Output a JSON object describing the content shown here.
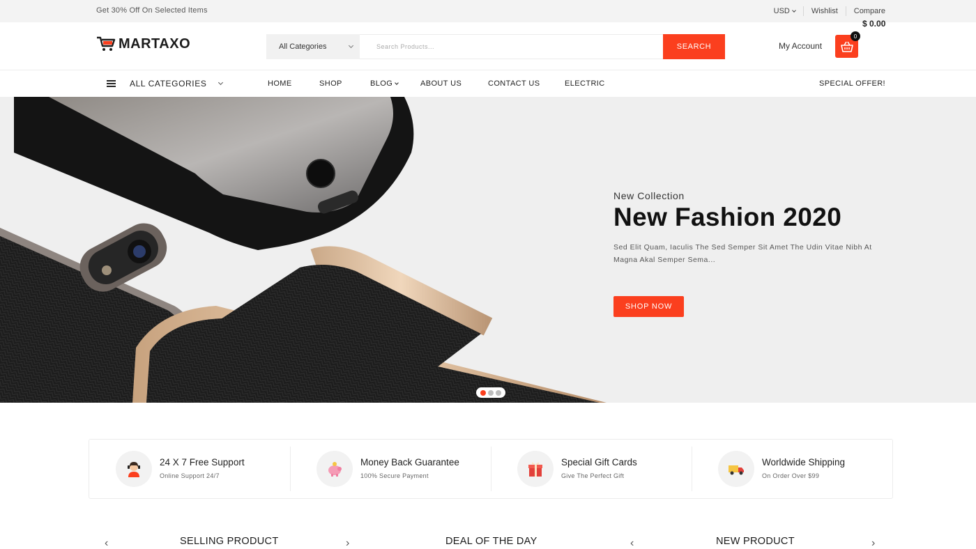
{
  "topbar": {
    "promo": "Get 30% Off On Selected Items",
    "currency": "USD",
    "wishlist": "Wishlist",
    "compare": "Compare"
  },
  "header": {
    "logo_text": "MARTAXO",
    "search": {
      "category_selected": "All Categories",
      "placeholder": "Search Products...",
      "button_label": "SEARCH"
    },
    "account_label": "My Account",
    "cart": {
      "count": "0",
      "total": "$ 0.00"
    }
  },
  "nav": {
    "all_categories": "ALL CATEGORIES",
    "items": [
      {
        "label": "HOME"
      },
      {
        "label": "SHOP"
      },
      {
        "label": "BLOG"
      },
      {
        "label": "ABOUT US"
      },
      {
        "label": "CONTACT US"
      },
      {
        "label": "ELECTRIC"
      }
    ],
    "special": "SPECIAL OFFER!"
  },
  "hero": {
    "kicker": "New Collection",
    "title": "New Fashion 2020",
    "description": "Sed Elit Quam, Iaculis The Sed Semper Sit Amet The Udin Vitae Nibh At Magna Akal Semper Sema...",
    "cta_label": "SHOP NOW",
    "slides_total": 3,
    "active_slide": 1
  },
  "features": [
    {
      "title": "24 X 7 Free Support",
      "subtitle": "Online Support 24/7",
      "icon": "support-agent-icon"
    },
    {
      "title": "Money Back Guarantee",
      "subtitle": "100% Secure Payment",
      "icon": "piggy-bank-icon"
    },
    {
      "title": "Special Gift Cards",
      "subtitle": "Give The Perfect Gift",
      "icon": "gift-icon"
    },
    {
      "title": "Worldwide Shipping",
      "subtitle": "On Order Over $99",
      "icon": "truck-icon"
    }
  ],
  "sections": {
    "selling": "SELLING PRODUCT",
    "deal": "DEAL OF THE DAY",
    "new": "NEW PRODUCT",
    "prev_arrow": "‹",
    "next_arrow": "›"
  },
  "colors": {
    "accent": "#fb3f1e",
    "topbar_bg": "#f3f3f3",
    "hero_bg": "#efefef"
  }
}
